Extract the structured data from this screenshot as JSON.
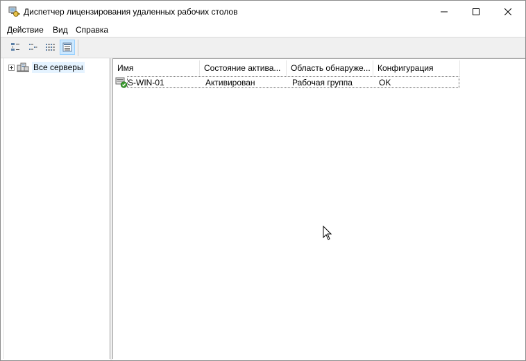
{
  "window": {
    "title": "Диспетчер лицензирования удаленных рабочих столов",
    "icons": {
      "app": "license-manager-icon",
      "minimize": "minimize-icon",
      "maximize": "maximize-icon",
      "close": "close-icon"
    }
  },
  "menu": {
    "items": [
      {
        "label": "Действие"
      },
      {
        "label": "Вид"
      },
      {
        "label": "Справка"
      }
    ]
  },
  "toolbar": {
    "buttons": [
      {
        "icon": "large-icons-view-icon",
        "active": false
      },
      {
        "icon": "small-icons-view-icon",
        "active": false
      },
      {
        "icon": "list-view-icon",
        "active": false
      },
      {
        "icon": "details-view-icon",
        "active": true
      }
    ]
  },
  "tree": {
    "root": {
      "label": "Все серверы",
      "icon": "servers-group-icon",
      "expander": "plus"
    }
  },
  "list": {
    "columns": [
      "Имя",
      "Состояние актива...",
      "Область обнаруже...",
      "Конфигурация"
    ],
    "rows": [
      {
        "name": "S-WIN-01",
        "status": "Активирован",
        "scope": "Рабочая группа",
        "config": "OK",
        "icon": "server-activated-icon"
      }
    ]
  },
  "colors": {
    "selection": "#cce8ff",
    "selection_border": "#99d1ff",
    "toolbar_bg": "#f0f0f0",
    "activated_check": "#3a9a2e"
  }
}
